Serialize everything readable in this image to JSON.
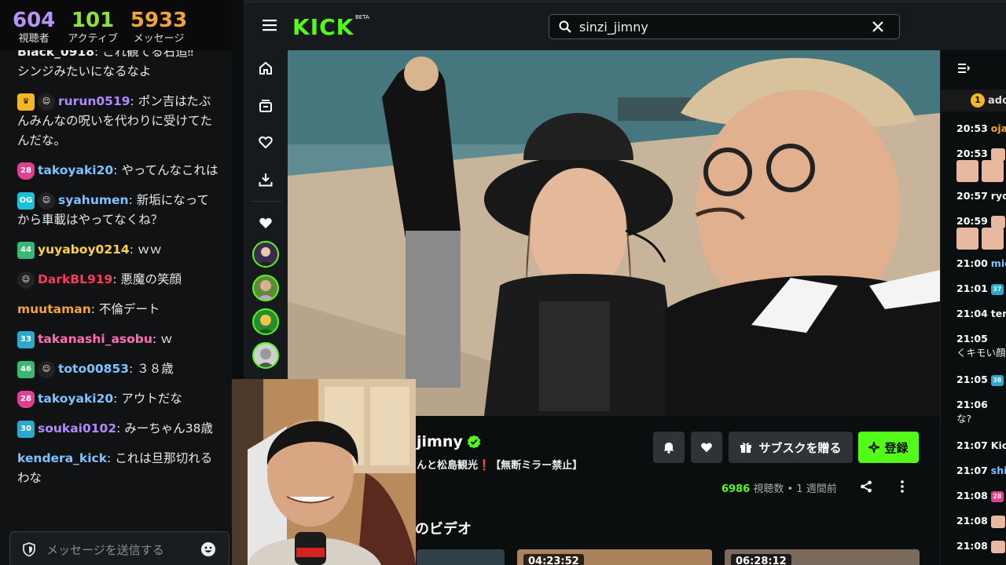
{
  "stats": {
    "viewers": {
      "value": "604",
      "label": "視聴者"
    },
    "active": {
      "value": "101",
      "label": "アクティブ"
    },
    "messages": {
      "value": "5933",
      "label": "メッセージ"
    }
  },
  "left_chat": {
    "messages": [
      {
        "user": "Black_0918",
        "user_color": "#f0f0f0",
        "text": "これ観てる右追‼",
        "badges": []
      },
      {
        "user": "",
        "user_color": "#f0f0f0",
        "text": "シンジみたいになるなよ",
        "badges": []
      },
      {
        "user": "rurun0519",
        "user_color": "#b08aff",
        "text": "ポン吉はたぶんみんなの呪いを代わりに受けてたんだな。",
        "badges": [
          "crown",
          "face"
        ]
      },
      {
        "user": "takoyaki20",
        "user_color": "#7ec3ff",
        "text": "やってんなこれは",
        "badges": [
          "28"
        ]
      },
      {
        "user": "syahumen",
        "user_color": "#7ec3ff",
        "text": "新垢になってから車載はやってなくね？",
        "badges": [
          "OG",
          "face"
        ]
      },
      {
        "user": "yuyaboy0214",
        "user_color": "#ffd33d",
        "text": "ｗｗ",
        "badges": [
          "44"
        ]
      },
      {
        "user": "DarkBL919",
        "user_color": "#ff3b5c",
        "text": "悪魔の笑顔",
        "badges": [
          "face"
        ]
      },
      {
        "user": "muutaman",
        "user_color": "#f2a33a",
        "text": "不倫デート",
        "badges": []
      },
      {
        "user": "takanashi_asobu",
        "user_color": "#ff6fb5",
        "text": "ｗ",
        "badges": [
          "33"
        ]
      },
      {
        "user": "toto00853",
        "user_color": "#7ec3ff",
        "text": "３８歳",
        "badges": [
          "46",
          "face"
        ]
      },
      {
        "user": "takoyaki20",
        "user_color": "#7ec3ff",
        "text": "アウトだな",
        "badges": [
          "28"
        ]
      },
      {
        "user": "soukai0102",
        "user_color": "#b08aff",
        "text": "みーちゃん38歳",
        "badges": [
          "30"
        ]
      },
      {
        "user": "kendera_kick",
        "user_color": "#7ec3ff",
        "text": "これは旦那切れるわな",
        "badges": []
      }
    ],
    "input_placeholder": "メッセージを送信する"
  },
  "header": {
    "logo": "KICK",
    "logo_badge": "BETA",
    "search_value": "sinzi_jimny"
  },
  "stream": {
    "name": "jimny",
    "title": "んと松島観光❗【無断ミラー禁止】",
    "gift_label": "サブスクを贈る",
    "subscribe_label": "登録",
    "view_count": "6986",
    "view_label": "視聴数",
    "time_ago": "1 週間前",
    "videos_heading": "のビデオ",
    "thumb_durations": [
      "04:23:52",
      "06:28:12"
    ]
  },
  "right_chat": {
    "pinned_rank": "1",
    "pinned_text": "ado",
    "messages": [
      {
        "time": "20:53",
        "name": "ojag",
        "color": "#f2a33a"
      },
      {
        "time": "20:53",
        "name": "",
        "color": "#ffffff"
      },
      {
        "time": "20:57",
        "name": "ryou",
        "color": "#f0f0f0"
      },
      {
        "time": "20:59",
        "name": "",
        "color": "#ffffff"
      },
      {
        "time": "21:00",
        "name": "mid",
        "color": "#7ec3ff"
      },
      {
        "time": "21:01",
        "name": "n",
        "color": "#f0f0f0"
      },
      {
        "time": "21:04",
        "name": "tent",
        "color": "#f0f0f0"
      },
      {
        "time": "21:05",
        "name": "くキモい顔",
        "color": "#f0f0f0"
      },
      {
        "time": "21:05",
        "name": "S",
        "color": "#7ec3ff"
      },
      {
        "time": "21:06",
        "name": "な?",
        "color": "#f0f0f0"
      },
      {
        "time": "21:07",
        "name": "Kick",
        "color": "#f0f0f0"
      },
      {
        "time": "21:07",
        "name": "shiw",
        "color": "#7ec3ff"
      },
      {
        "time": "21:08",
        "name": "r",
        "color": "#ff6fb5"
      },
      {
        "time": "21:08",
        "name": "",
        "color": "#ffffff"
      },
      {
        "time": "21:08",
        "name": "",
        "color": "#ffffff"
      }
    ]
  },
  "colors": {
    "brand": "#53fc18",
    "bg": "#0b0e0f",
    "panel": "#171a1c"
  }
}
